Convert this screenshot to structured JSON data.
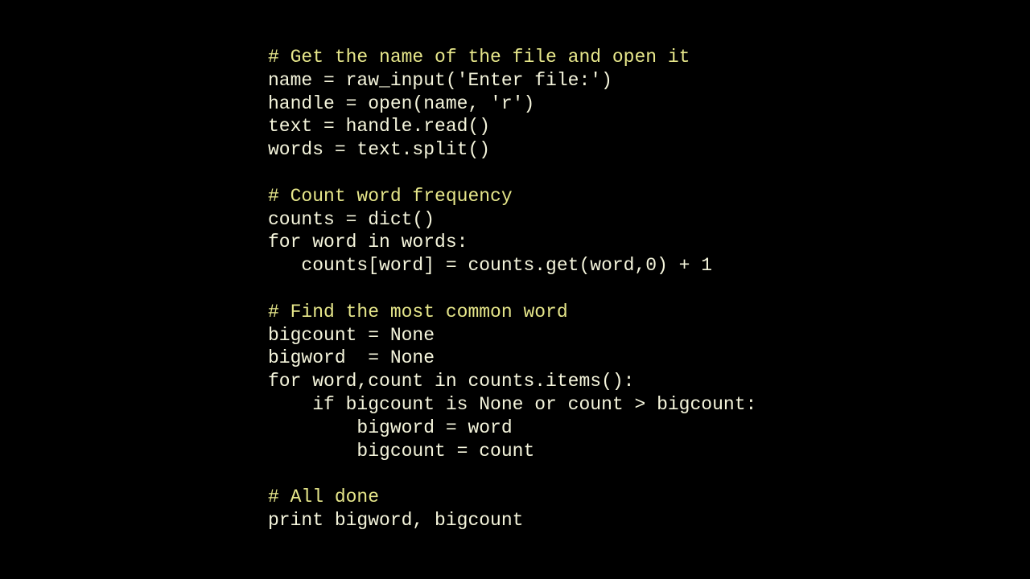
{
  "code": {
    "lines": [
      {
        "type": "comment",
        "text": "# Get the name of the file and open it"
      },
      {
        "type": "code",
        "text": "name = raw_input('Enter file:')"
      },
      {
        "type": "code",
        "text": "handle = open(name, 'r')"
      },
      {
        "type": "code",
        "text": "text = handle.read()"
      },
      {
        "type": "code",
        "text": "words = text.split()"
      },
      {
        "type": "blank",
        "text": ""
      },
      {
        "type": "comment",
        "text": "# Count word frequency"
      },
      {
        "type": "code",
        "text": "counts = dict()"
      },
      {
        "type": "code",
        "text": "for word in words:"
      },
      {
        "type": "code",
        "text": "   counts[word] = counts.get(word,0) + 1"
      },
      {
        "type": "blank",
        "text": ""
      },
      {
        "type": "comment",
        "text": "# Find the most common word"
      },
      {
        "type": "code",
        "text": "bigcount = None"
      },
      {
        "type": "code",
        "text": "bigword  = None"
      },
      {
        "type": "code",
        "text": "for word,count in counts.items():"
      },
      {
        "type": "code",
        "text": "    if bigcount is None or count > bigcount:"
      },
      {
        "type": "code",
        "text": "        bigword = word"
      },
      {
        "type": "code",
        "text": "        bigcount = count"
      },
      {
        "type": "blank",
        "text": ""
      },
      {
        "type": "comment",
        "text": "# All done"
      },
      {
        "type": "code",
        "text": "print bigword, bigcount"
      }
    ]
  }
}
